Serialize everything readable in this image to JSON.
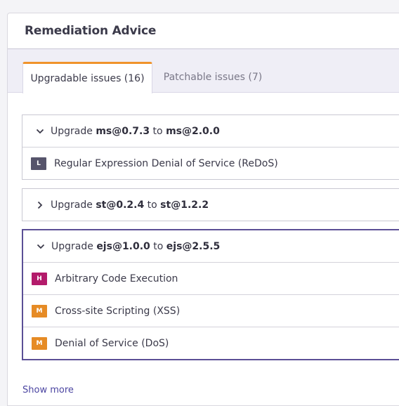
{
  "panel": {
    "title": "Remediation Advice"
  },
  "tabs": [
    {
      "label": "Upgradable issues (16)",
      "active": true
    },
    {
      "label": "Patchable issues (7)",
      "active": false
    }
  ],
  "groups": [
    {
      "prefix": "Upgrade",
      "from": "ms@0.7.3",
      "connector": "to",
      "to": "ms@2.0.0",
      "expanded": true,
      "issues": [
        {
          "severity": "L",
          "severity_color": "#56546b",
          "title": "Regular Expression Denial of Service (ReDoS)"
        }
      ]
    },
    {
      "prefix": "Upgrade",
      "from": "st@0.2.4",
      "connector": "to",
      "to": "st@1.2.2",
      "expanded": false,
      "issues": []
    },
    {
      "prefix": "Upgrade",
      "from": "ejs@1.0.0",
      "connector": "to",
      "to": "ejs@2.5.5",
      "expanded": true,
      "issues": [
        {
          "severity": "H",
          "severity_color": "#b31b6b",
          "title": "Arbitrary Code Execution"
        },
        {
          "severity": "M",
          "severity_color": "#e68b25",
          "title": "Cross-site Scripting (XSS)"
        },
        {
          "severity": "M",
          "severity_color": "#e68b25",
          "title": "Denial of Service (DoS)"
        }
      ]
    }
  ],
  "show_more": "Show more",
  "colors": {
    "accent_orange": "#f0932b",
    "selected_border": "#5b4f96",
    "link": "#4b45a1"
  }
}
